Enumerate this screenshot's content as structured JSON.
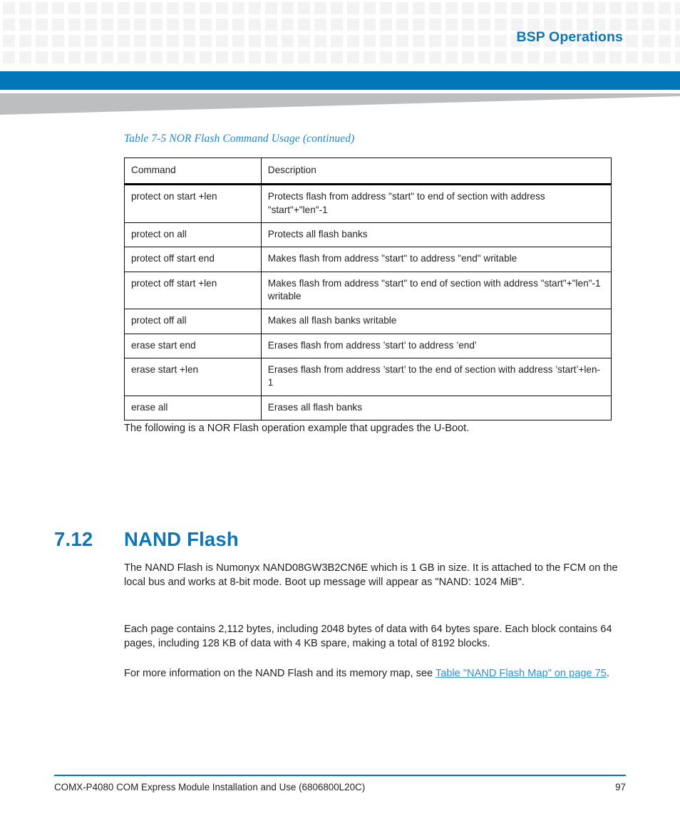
{
  "header": {
    "chapter_title": "BSP Operations",
    "accent_blue": "#0077b9",
    "heading_blue": "#0f76b4",
    "link_blue": "#2b92cf",
    "caption_blue": "#1f86c5",
    "grid_square_color": "#f3f3f3",
    "wedge_color": "#bcbec0"
  },
  "table": {
    "caption": "Table 7-5 NOR Flash Command Usage  (continued)",
    "columns": [
      "Command",
      "Description"
    ],
    "rows": [
      {
        "command": "protect on start +len",
        "description": "Protects flash from address \"start\" to end of section with address \"start\"+\"len\"-1"
      },
      {
        "command": "protect on  all",
        "description": "Protects all flash banks"
      },
      {
        "command": "protect off start end",
        "description": "Makes flash from address \"start\" to address \"end\" writable"
      },
      {
        "command": "protect off start +len",
        "description": "Makes flash from address \"start\" to end of section with address \"start\"+\"len\"-1 writable"
      },
      {
        "command": "protect off all",
        "description": "Makes all flash banks writable"
      },
      {
        "command": "erase start end",
        "description": "Erases flash from address ’start’ to address ’end’"
      },
      {
        "command": "erase start +len",
        "description": "Erases flash from address ’start’ to the end of section with address ’start’+len-1"
      },
      {
        "command": "erase all",
        "description": "Erases all flash banks"
      }
    ]
  },
  "body": {
    "nor_example_paragraph": "The following is a NOR Flash operation example that upgrades the U-Boot.",
    "section": {
      "number": "7.12",
      "title": "NAND Flash"
    },
    "paragraph_1": "The NAND Flash is Numonyx NAND08GW3B2CN6E which is 1 GB in size. It is attached to the FCM on the local bus and works at 8-bit mode. Boot up message will appear as \"NAND: 1024 MiB\".",
    "paragraph_2": "Each page contains 2,112 bytes, including 2048 bytes of data with 64 bytes spare. Each block contains 64 pages, including 128 KB of data with 4 KB spare, making a total of 8192 blocks.",
    "paragraph_3_lead": "For more information on the NAND Flash and its memory map, see ",
    "paragraph_3_link": "Table \"NAND Flash Map\" on page 75",
    "paragraph_3_tail": "."
  },
  "footer": {
    "document_title": "COMX-P4080 COM Express Module Installation and Use (6806800L20C)",
    "page_number": "97"
  }
}
